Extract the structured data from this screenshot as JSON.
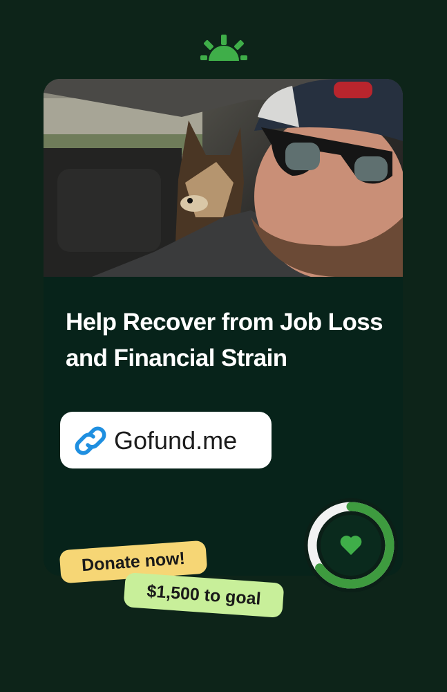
{
  "brand": {
    "logo_icon": "gofundme-sun-icon",
    "accent": "#3fae49"
  },
  "campaign": {
    "photo_alt": "",
    "title": "Help Recover from Job Loss and Financial Strain",
    "link": {
      "icon": "link-icon",
      "text": "Gofund.me"
    }
  },
  "progress": {
    "fraction": 0.65,
    "icon": "heart-icon"
  },
  "tags": {
    "donate": "Donate now!",
    "goal": "$1,500 to goal"
  },
  "colors": {
    "background": "#0d2419",
    "card": "#07231a",
    "donate_tag": "#f6d675",
    "goal_tag": "#c8ef9a",
    "ring_track": "#f2f2f2",
    "ring_fill": "#3e9b3f"
  }
}
